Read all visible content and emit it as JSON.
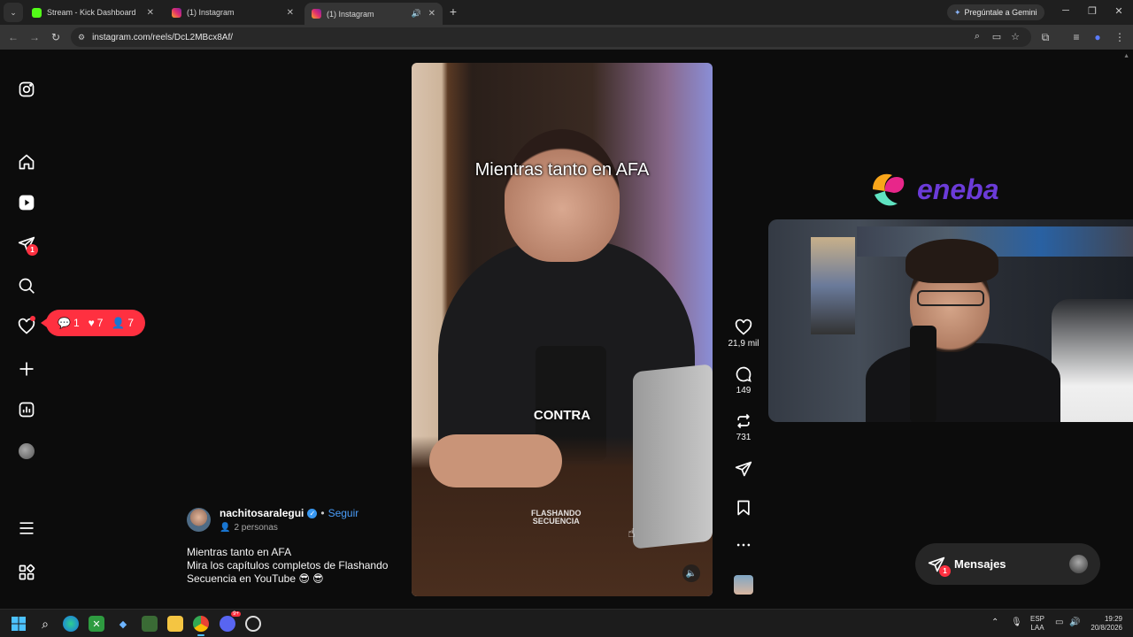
{
  "browser": {
    "tabs": [
      {
        "title": "Stream - Kick Dashboard",
        "favicon_color": "#53fc18",
        "active": false
      },
      {
        "title": "(1) Instagram",
        "favicon_color": "#e1306c",
        "active": false
      },
      {
        "title": "(1) Instagram",
        "favicon_color": "#e1306c",
        "active": true
      }
    ],
    "gemini_label": "Pregúntale a Gemini",
    "url": "instagram.com/reels/DcL2MBcx8Af/"
  },
  "sidebar": {
    "messages_badge": "1",
    "notifications": {
      "comments": "1",
      "likes": "7",
      "follows": "7"
    }
  },
  "reel": {
    "caption_top": "Mientras tanto en AFA",
    "caption_mid": "CONTRA",
    "watermark_line1": "FLASHANDO",
    "watermark_line2": "SECUENCIA"
  },
  "actions": {
    "likes": "21,9 mil",
    "comments": "149",
    "reposts": "731"
  },
  "caption": {
    "username": "nachitosaralegui",
    "separator": "•",
    "follow_label": "Seguir",
    "people": "2 personas",
    "line1": "Mientras tanto en AFA",
    "line2": "Mira los capítulos completos de Flashando",
    "line3": "Secuencia en YouTube 😎 😎"
  },
  "overlay": {
    "sponsor": "eneba"
  },
  "messages": {
    "label": "Mensajes",
    "badge": "1"
  },
  "taskbar": {
    "lang_line1": "ESP",
    "lang_line2": "LAA",
    "time": "19:29",
    "date": "20/8/2026",
    "discord_badge": "9+"
  },
  "colors": {
    "accent_blue": "#4a9df8",
    "badge_red": "#ff3040",
    "eneba_purple": "#6b3bd8"
  }
}
